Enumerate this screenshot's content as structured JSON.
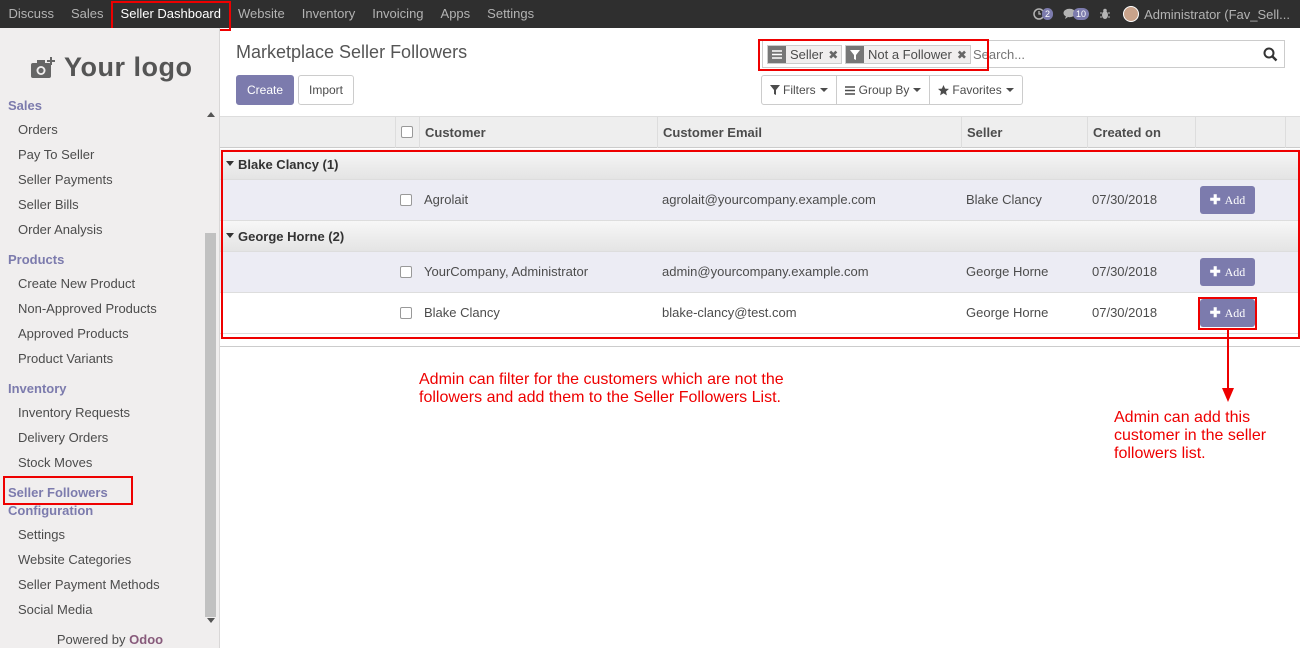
{
  "topbar": {
    "menu": [
      "Discuss",
      "Sales",
      "Seller Dashboard",
      "Website",
      "Inventory",
      "Invoicing",
      "Apps",
      "Settings"
    ],
    "activity_count": "2",
    "message_count": "10",
    "user": "Administrator (Fav_Sell..."
  },
  "sidebar": {
    "logo_text": "Your logo",
    "sections": [
      {
        "title": "Sales",
        "items": [
          "Orders",
          "Pay To Seller",
          "Seller Payments",
          "Seller Bills",
          "Order Analysis"
        ]
      },
      {
        "title": "Products",
        "items": [
          "Create New Product",
          "Non-Approved Products",
          "Approved Products",
          "Product Variants"
        ]
      },
      {
        "title": "Inventory",
        "items": [
          "Inventory Requests",
          "Delivery Orders",
          "Stock Moves"
        ]
      },
      {
        "title": "Seller Followers",
        "items": []
      },
      {
        "title": "Configuration",
        "items": [
          "Settings",
          "Website Categories",
          "Seller Payment Methods",
          "Social Media"
        ]
      }
    ],
    "powered_by": "Powered by",
    "powered_brand": "Odoo"
  },
  "page": {
    "title": "Marketplace Seller Followers",
    "create_label": "Create",
    "import_label": "Import"
  },
  "search": {
    "facets": [
      {
        "icon": "list-icon",
        "label": "Seller"
      },
      {
        "icon": "filter-icon",
        "label": "Not a Follower"
      }
    ],
    "placeholder": "Search...",
    "filters_label": "Filters",
    "groupby_label": "Group By",
    "favorites_label": "Favorites"
  },
  "table": {
    "columns": [
      "Customer",
      "Customer Email",
      "Seller",
      "Created on"
    ],
    "groups": [
      {
        "label": "Blake Clancy (1)",
        "rows": [
          {
            "customer": "Agrolait",
            "email": "agrolait@yourcompany.example.com",
            "seller": "Blake Clancy",
            "created": "07/30/2018",
            "action": "Add"
          }
        ]
      },
      {
        "label": "George Horne (2)",
        "rows": [
          {
            "customer": "YourCompany, Administrator",
            "email": "admin@yourcompany.example.com",
            "seller": "George Horne",
            "created": "07/30/2018",
            "action": "Add"
          },
          {
            "customer": "Blake Clancy",
            "email": "blake-clancy@test.com",
            "seller": "George Horne",
            "created": "07/30/2018",
            "action": "Add"
          }
        ]
      }
    ]
  },
  "annotations": {
    "note1_line1": "Admin can filter for the customers which are not the",
    "note1_line2": "followers and add them to the Seller Followers List.",
    "note2_line1": "Admin can add this",
    "note2_line2": "customer in the seller",
    "note2_line3": "followers list."
  },
  "colors": {
    "brand": "#7c7bad",
    "navbar": "#2f2f2f",
    "annotation": "#ee0000",
    "odoo": "#875a7b"
  }
}
